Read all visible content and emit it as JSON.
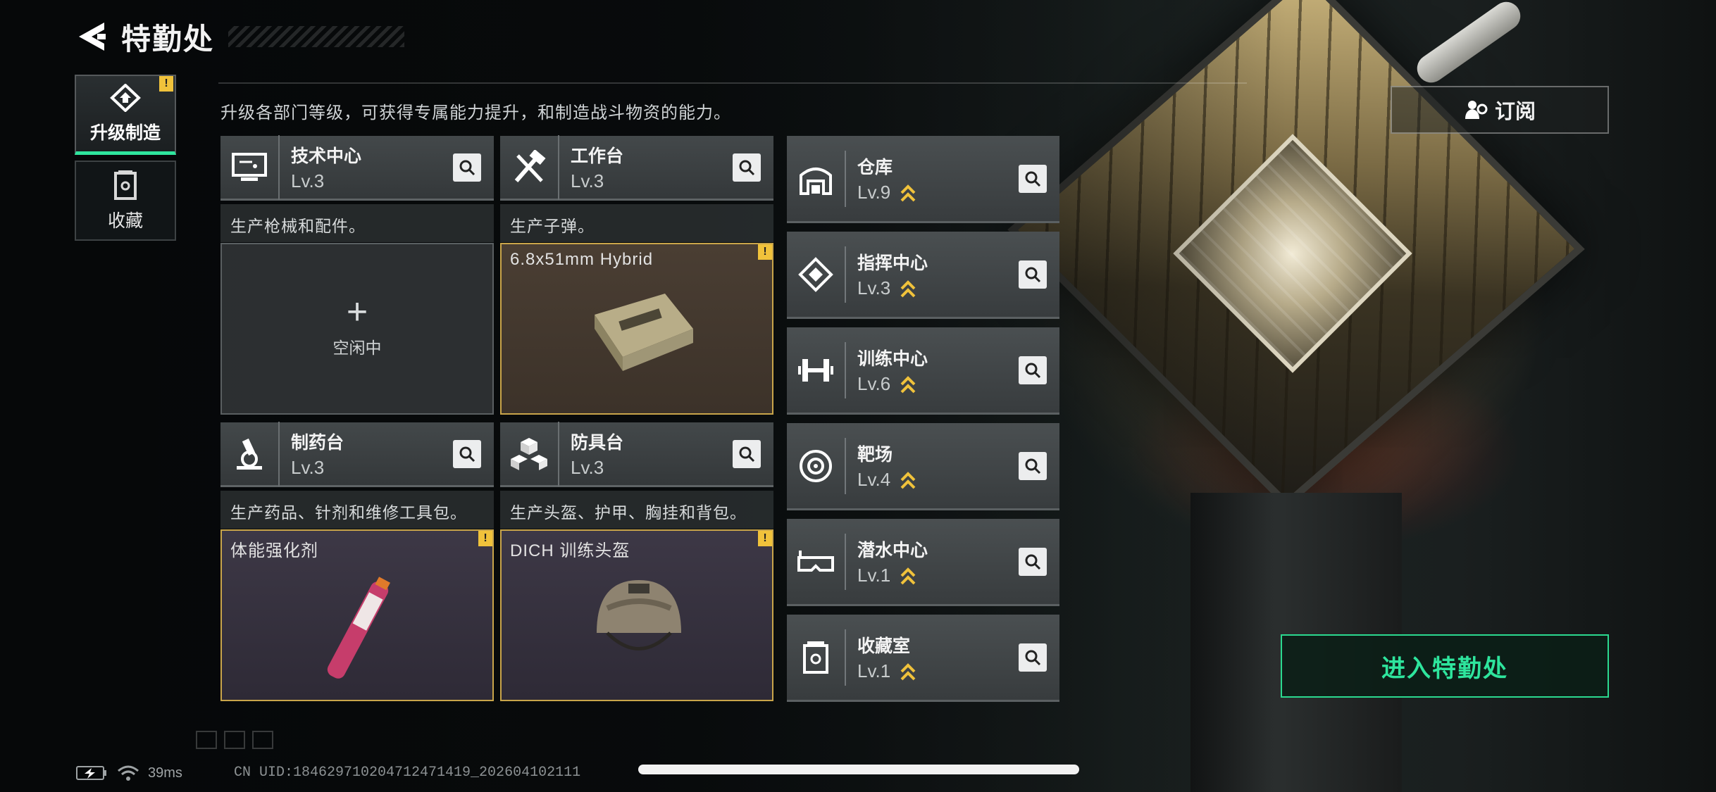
{
  "header": {
    "title": "特勤处"
  },
  "nav": [
    {
      "label": "升级制造",
      "active": true,
      "badge": "!"
    },
    {
      "label": "收藏",
      "active": false
    }
  ],
  "description": "升级各部门等级，可获得专属能力提升，和制造战斗物资的能力。",
  "workbenches": [
    {
      "name": "技术中心",
      "level": "Lv.3",
      "icon": "monitor-icon",
      "subtitle": "生产枪械和配件。",
      "slot": {
        "state": "idle",
        "label": "空闲中"
      }
    },
    {
      "name": "工作台",
      "level": "Lv.3",
      "icon": "tools-icon",
      "subtitle": "生产子弹。",
      "slot": {
        "state": "crafting",
        "item": "6.8x51mm Hybrid",
        "badge": "!"
      }
    },
    {
      "name": "制药台",
      "level": "Lv.3",
      "icon": "microscope-icon",
      "subtitle": "生产药品、针剂和维修工具包。",
      "slot": {
        "state": "crafting",
        "item": "体能强化剂",
        "badge": "!"
      }
    },
    {
      "name": "防具台",
      "level": "Lv.3",
      "icon": "armor-blocks-icon",
      "subtitle": "生产头盔、护甲、胸挂和背包。",
      "slot": {
        "state": "crafting",
        "item": "DICH 训练头盔",
        "badge": "!"
      }
    }
  ],
  "facilities": [
    {
      "name": "仓库",
      "level": "Lv.9",
      "icon": "warehouse-icon"
    },
    {
      "name": "指挥中心",
      "level": "Lv.3",
      "icon": "command-chip-icon"
    },
    {
      "name": "训练中心",
      "level": "Lv.6",
      "icon": "dumbbell-icon"
    },
    {
      "name": "靶场",
      "level": "Lv.4",
      "icon": "target-icon"
    },
    {
      "name": "潜水中心",
      "level": "Lv.1",
      "icon": "diving-mask-icon"
    },
    {
      "name": "收藏室",
      "level": "Lv.1",
      "icon": "collection-icon"
    }
  ],
  "buttons": {
    "subscribe": "订阅",
    "enter": "进入特勤处"
  },
  "status": {
    "ping": "39ms",
    "uid": "CN UID:18462971020471247141​9_202604102111"
  },
  "colors": {
    "accent": "#2ee59d",
    "warning": "#f0c23b",
    "gold_border": "#c9a54a"
  }
}
